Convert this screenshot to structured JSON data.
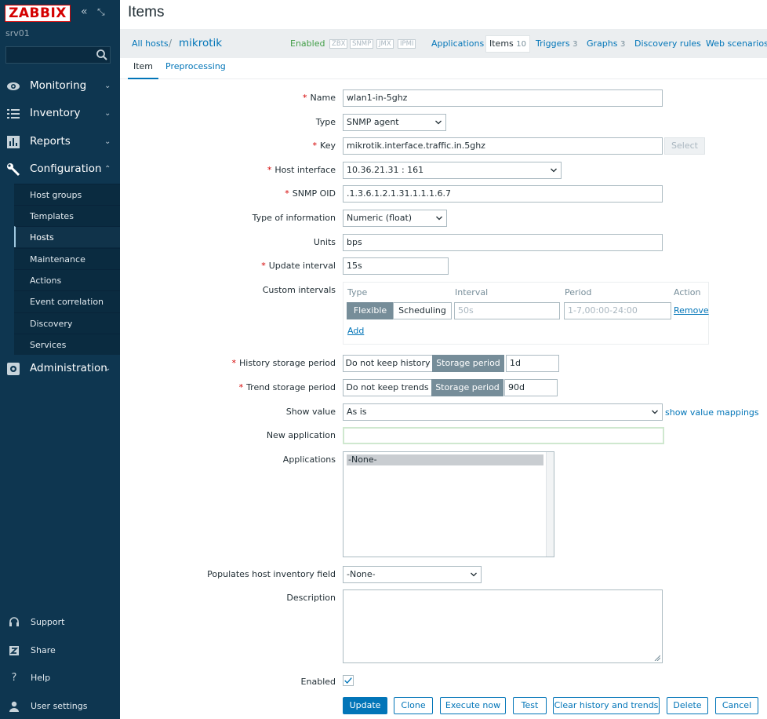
{
  "app": {
    "logo": "ZABBIX",
    "server": "srv01"
  },
  "sidebar": {
    "search": {
      "value": "",
      "placeholder": ""
    },
    "menu": [
      {
        "label": "Monitoring",
        "icon": "eye-icon"
      },
      {
        "label": "Inventory",
        "icon": "list-icon"
      },
      {
        "label": "Reports",
        "icon": "bar-chart-icon"
      },
      {
        "label": "Configuration",
        "icon": "wrench-icon"
      },
      {
        "label": "Administration",
        "icon": "gear-icon"
      }
    ],
    "config_submenu": [
      "Host groups",
      "Templates",
      "Hosts",
      "Maintenance",
      "Actions",
      "Event correlation",
      "Discovery",
      "Services"
    ],
    "selected_submenu": "Hosts",
    "bottom": [
      {
        "label": "Support",
        "icon": "headset-icon"
      },
      {
        "label": "Share",
        "icon": "share-icon"
      },
      {
        "label": "Help",
        "icon": "question-icon"
      },
      {
        "label": "User settings",
        "icon": "user-icon"
      }
    ]
  },
  "page": {
    "title": "Items"
  },
  "breadcrumb": {
    "all_hosts": "All hosts",
    "separator": "/",
    "host": "mikrotik"
  },
  "host_nav": {
    "status": "Enabled",
    "tags": [
      "ZBX",
      "SNMP",
      "JMX",
      "IPMI"
    ],
    "applications": "Applications",
    "items": "Items",
    "items_count": "10",
    "triggers": "Triggers",
    "triggers_count": "3",
    "graphs": "Graphs",
    "graphs_count": "3",
    "discovery": "Discovery rules",
    "web": "Web scenarios"
  },
  "tabs": {
    "item": "Item",
    "preprocessing": "Preprocessing"
  },
  "form": {
    "name": {
      "label": "Name",
      "value": "wlan1-in-5ghz"
    },
    "type": {
      "label": "Type",
      "value": "SNMP agent"
    },
    "key": {
      "label": "Key",
      "value": "mikrotik.interface.traffic.in.5ghz",
      "select": "Select"
    },
    "host_interface": {
      "label": "Host interface",
      "value": "10.36.21.31 : 161"
    },
    "snmp_oid": {
      "label": "SNMP OID",
      "value": ".1.3.6.1.2.1.31.1.1.1.6.7"
    },
    "type_info": {
      "label": "Type of information",
      "value": "Numeric (float)"
    },
    "units": {
      "label": "Units",
      "value": "bps"
    },
    "update_interval": {
      "label": "Update interval",
      "value": "15s"
    },
    "custom_intervals": {
      "label": "Custom intervals",
      "headers": {
        "type": "Type",
        "interval": "Interval",
        "period": "Period",
        "action": "Action"
      },
      "flexible": "Flexible",
      "scheduling": "Scheduling",
      "interval_placeholder": "50s",
      "period_placeholder": "1-7,00:00-24:00",
      "remove": "Remove",
      "add": "Add"
    },
    "history": {
      "label": "History storage period",
      "opt1": "Do not keep history",
      "opt2": "Storage period",
      "value": "1d"
    },
    "trends": {
      "label": "Trend storage period",
      "opt1": "Do not keep trends",
      "opt2": "Storage period",
      "value": "90d"
    },
    "show_value": {
      "label": "Show value",
      "value": "As is",
      "link": "show value mappings"
    },
    "new_application": {
      "label": "New application",
      "value": ""
    },
    "applications": {
      "label": "Applications",
      "selected": "-None-"
    },
    "inventory": {
      "label": "Populates host inventory field",
      "value": "-None-"
    },
    "description": {
      "label": "Description",
      "value": ""
    },
    "enabled": {
      "label": "Enabled",
      "checked": true
    }
  },
  "actions": {
    "update": "Update",
    "clone": "Clone",
    "execute": "Execute now",
    "test": "Test",
    "clear": "Clear history and trends",
    "delete": "Delete",
    "cancel": "Cancel"
  },
  "colors": {
    "sidebar_bg": "#0e3650",
    "accent": "#0275b8",
    "enabled_green": "#429e47",
    "required": "#d40000",
    "logo_red": "#d40000"
  }
}
